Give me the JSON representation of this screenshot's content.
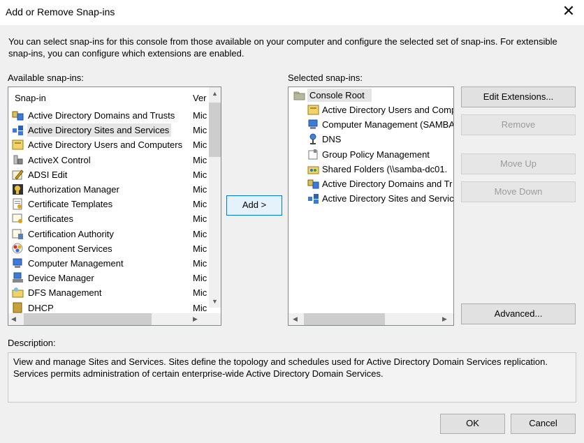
{
  "window": {
    "title": "Add or Remove Snap-ins",
    "close_icon": "close-icon"
  },
  "intro": "You can select snap-ins for this console from those available on your computer and configure the selected set of snap-ins. For extensible snap-ins, you can configure which extensions are enabled.",
  "available": {
    "label": "Available snap-ins:",
    "col_snapin": "Snap-in",
    "col_vendor": "Ver",
    "items": [
      {
        "name": "Active Directory Domains and Trusts",
        "vendor": "Mic",
        "icon": "ad-domains-icon"
      },
      {
        "name": "Active Directory Sites and Services",
        "vendor": "Mic",
        "icon": "ad-sites-icon",
        "selected": true
      },
      {
        "name": "Active Directory Users and Computers",
        "vendor": "Mic",
        "icon": "ad-users-icon"
      },
      {
        "name": "ActiveX Control",
        "vendor": "Mic",
        "icon": "activex-icon"
      },
      {
        "name": "ADSI Edit",
        "vendor": "Mic",
        "icon": "adsi-edit-icon"
      },
      {
        "name": "Authorization Manager",
        "vendor": "Mic",
        "icon": "authorization-icon"
      },
      {
        "name": "Certificate Templates",
        "vendor": "Mic",
        "icon": "cert-templates-icon"
      },
      {
        "name": "Certificates",
        "vendor": "Mic",
        "icon": "certificates-icon"
      },
      {
        "name": "Certification Authority",
        "vendor": "Mic",
        "icon": "cert-authority-icon"
      },
      {
        "name": "Component Services",
        "vendor": "Mic",
        "icon": "component-services-icon"
      },
      {
        "name": "Computer Management",
        "vendor": "Mic",
        "icon": "computer-management-icon"
      },
      {
        "name": "Device Manager",
        "vendor": "Mic",
        "icon": "device-manager-icon"
      },
      {
        "name": "DFS Management",
        "vendor": "Mic",
        "icon": "dfs-icon"
      },
      {
        "name": "DHCP",
        "vendor": "Mic",
        "icon": "dhcp-icon"
      }
    ]
  },
  "add_button": "Add >",
  "selected": {
    "label": "Selected snap-ins:",
    "root": "Console Root",
    "items": [
      {
        "name": "Active Directory Users and Comp",
        "icon": "ad-users-icon"
      },
      {
        "name": "Computer Management (SAMBA",
        "icon": "computer-management-icon"
      },
      {
        "name": "DNS",
        "icon": "dns-icon"
      },
      {
        "name": "Group Policy Management",
        "icon": "group-policy-icon"
      },
      {
        "name": "Shared Folders (\\\\samba-dc01.",
        "icon": "shared-folders-icon"
      },
      {
        "name": "Active Directory Domains and Tr",
        "icon": "ad-domains-icon"
      },
      {
        "name": "Active Directory Sites and Servic",
        "icon": "ad-sites-icon"
      }
    ]
  },
  "buttons": {
    "edit_extensions": "Edit Extensions...",
    "remove": "Remove",
    "move_up": "Move Up",
    "move_down": "Move Down",
    "advanced": "Advanced...",
    "ok": "OK",
    "cancel": "Cancel"
  },
  "description": {
    "label": "Description:",
    "text": "View and manage Sites and Services. Sites define the topology and schedules used for Active Directory Domain Services replication. Services permits administration of certain enterprise-wide Active Directory Domain Services."
  },
  "colors": {
    "accent": "#0078d7",
    "selection": "#e5e5e5"
  }
}
